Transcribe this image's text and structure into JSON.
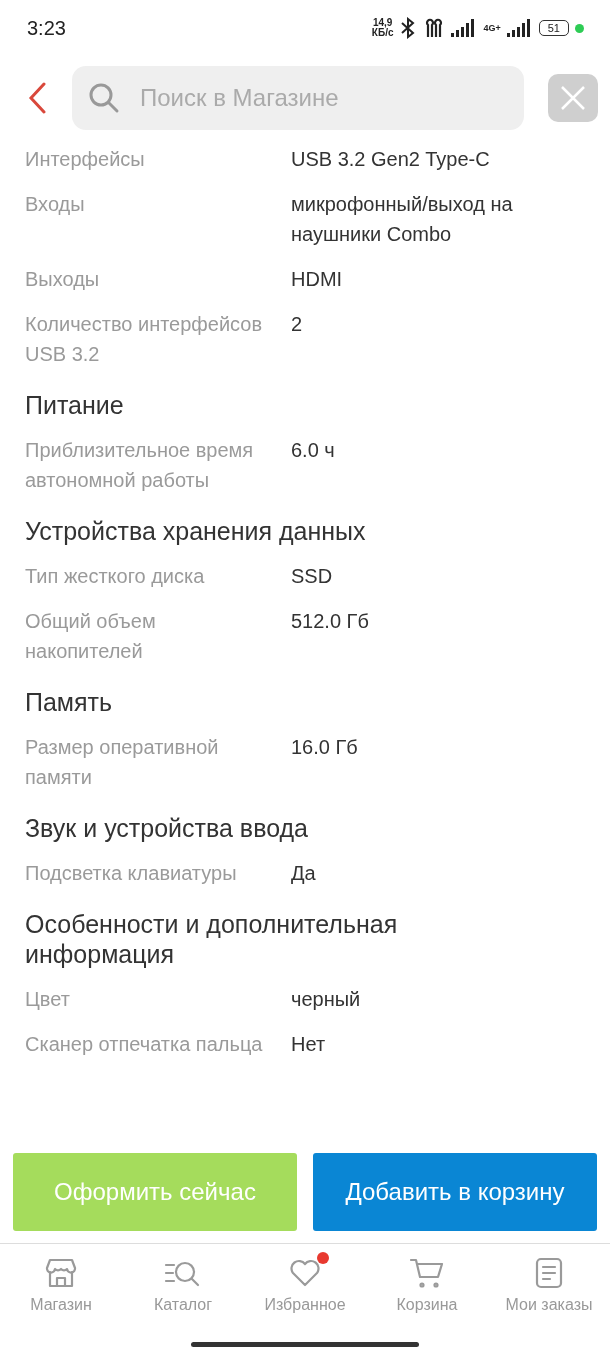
{
  "status_bar": {
    "time": "3:23",
    "speed": "14,9",
    "speed_unit": "КБ/с",
    "network": "4G+",
    "battery": "51"
  },
  "search": {
    "placeholder": "Поиск в Магазине"
  },
  "specs": [
    {
      "kind": "row",
      "label": "Интерфейсы",
      "value": "USB 3.2 Gen2 Type-C"
    },
    {
      "kind": "row",
      "label": "Входы",
      "value": "микрофонный/выход на наушники Combo"
    },
    {
      "kind": "row",
      "label": "Выходы",
      "value": "HDMI"
    },
    {
      "kind": "row",
      "label": "Количество интерфейсов USB 3.2",
      "value": "2"
    },
    {
      "kind": "heading",
      "label": "Питание"
    },
    {
      "kind": "row",
      "label": "Приблизительное время автономной работы",
      "value": "6.0 ч"
    },
    {
      "kind": "heading",
      "label": "Устройства хранения данных"
    },
    {
      "kind": "row",
      "label": "Тип жесткого диска",
      "value": "SSD"
    },
    {
      "kind": "row",
      "label": "Общий объем накопителей",
      "value": "512.0 Гб"
    },
    {
      "kind": "heading",
      "label": "Память"
    },
    {
      "kind": "row",
      "label": "Размер оперативной памяти",
      "value": "16.0 Гб"
    },
    {
      "kind": "heading",
      "label": "Звук и устройства ввода"
    },
    {
      "kind": "row",
      "label": "Подсветка клавиатуры",
      "value": "Да"
    },
    {
      "kind": "heading",
      "label": "Особенности и дополнительная информация"
    },
    {
      "kind": "row",
      "label": "Цвет",
      "value": "черный"
    },
    {
      "kind": "row",
      "label": "Сканер отпечатка пальца",
      "value": "Нет"
    }
  ],
  "actions": [
    {
      "kind": "buy",
      "label": "Оформить сейчас"
    },
    {
      "kind": "cart",
      "label": "Добавить в корзину"
    }
  ],
  "nav": [
    {
      "kind": "store",
      "label": "Магазин",
      "badge": false
    },
    {
      "kind": "catalog",
      "label": "Каталог",
      "badge": false
    },
    {
      "kind": "favorites",
      "label": "Избранное",
      "badge": true
    },
    {
      "kind": "cart",
      "label": "Корзина",
      "badge": false
    },
    {
      "kind": "orders",
      "label": "Мои заказы",
      "badge": false
    }
  ]
}
